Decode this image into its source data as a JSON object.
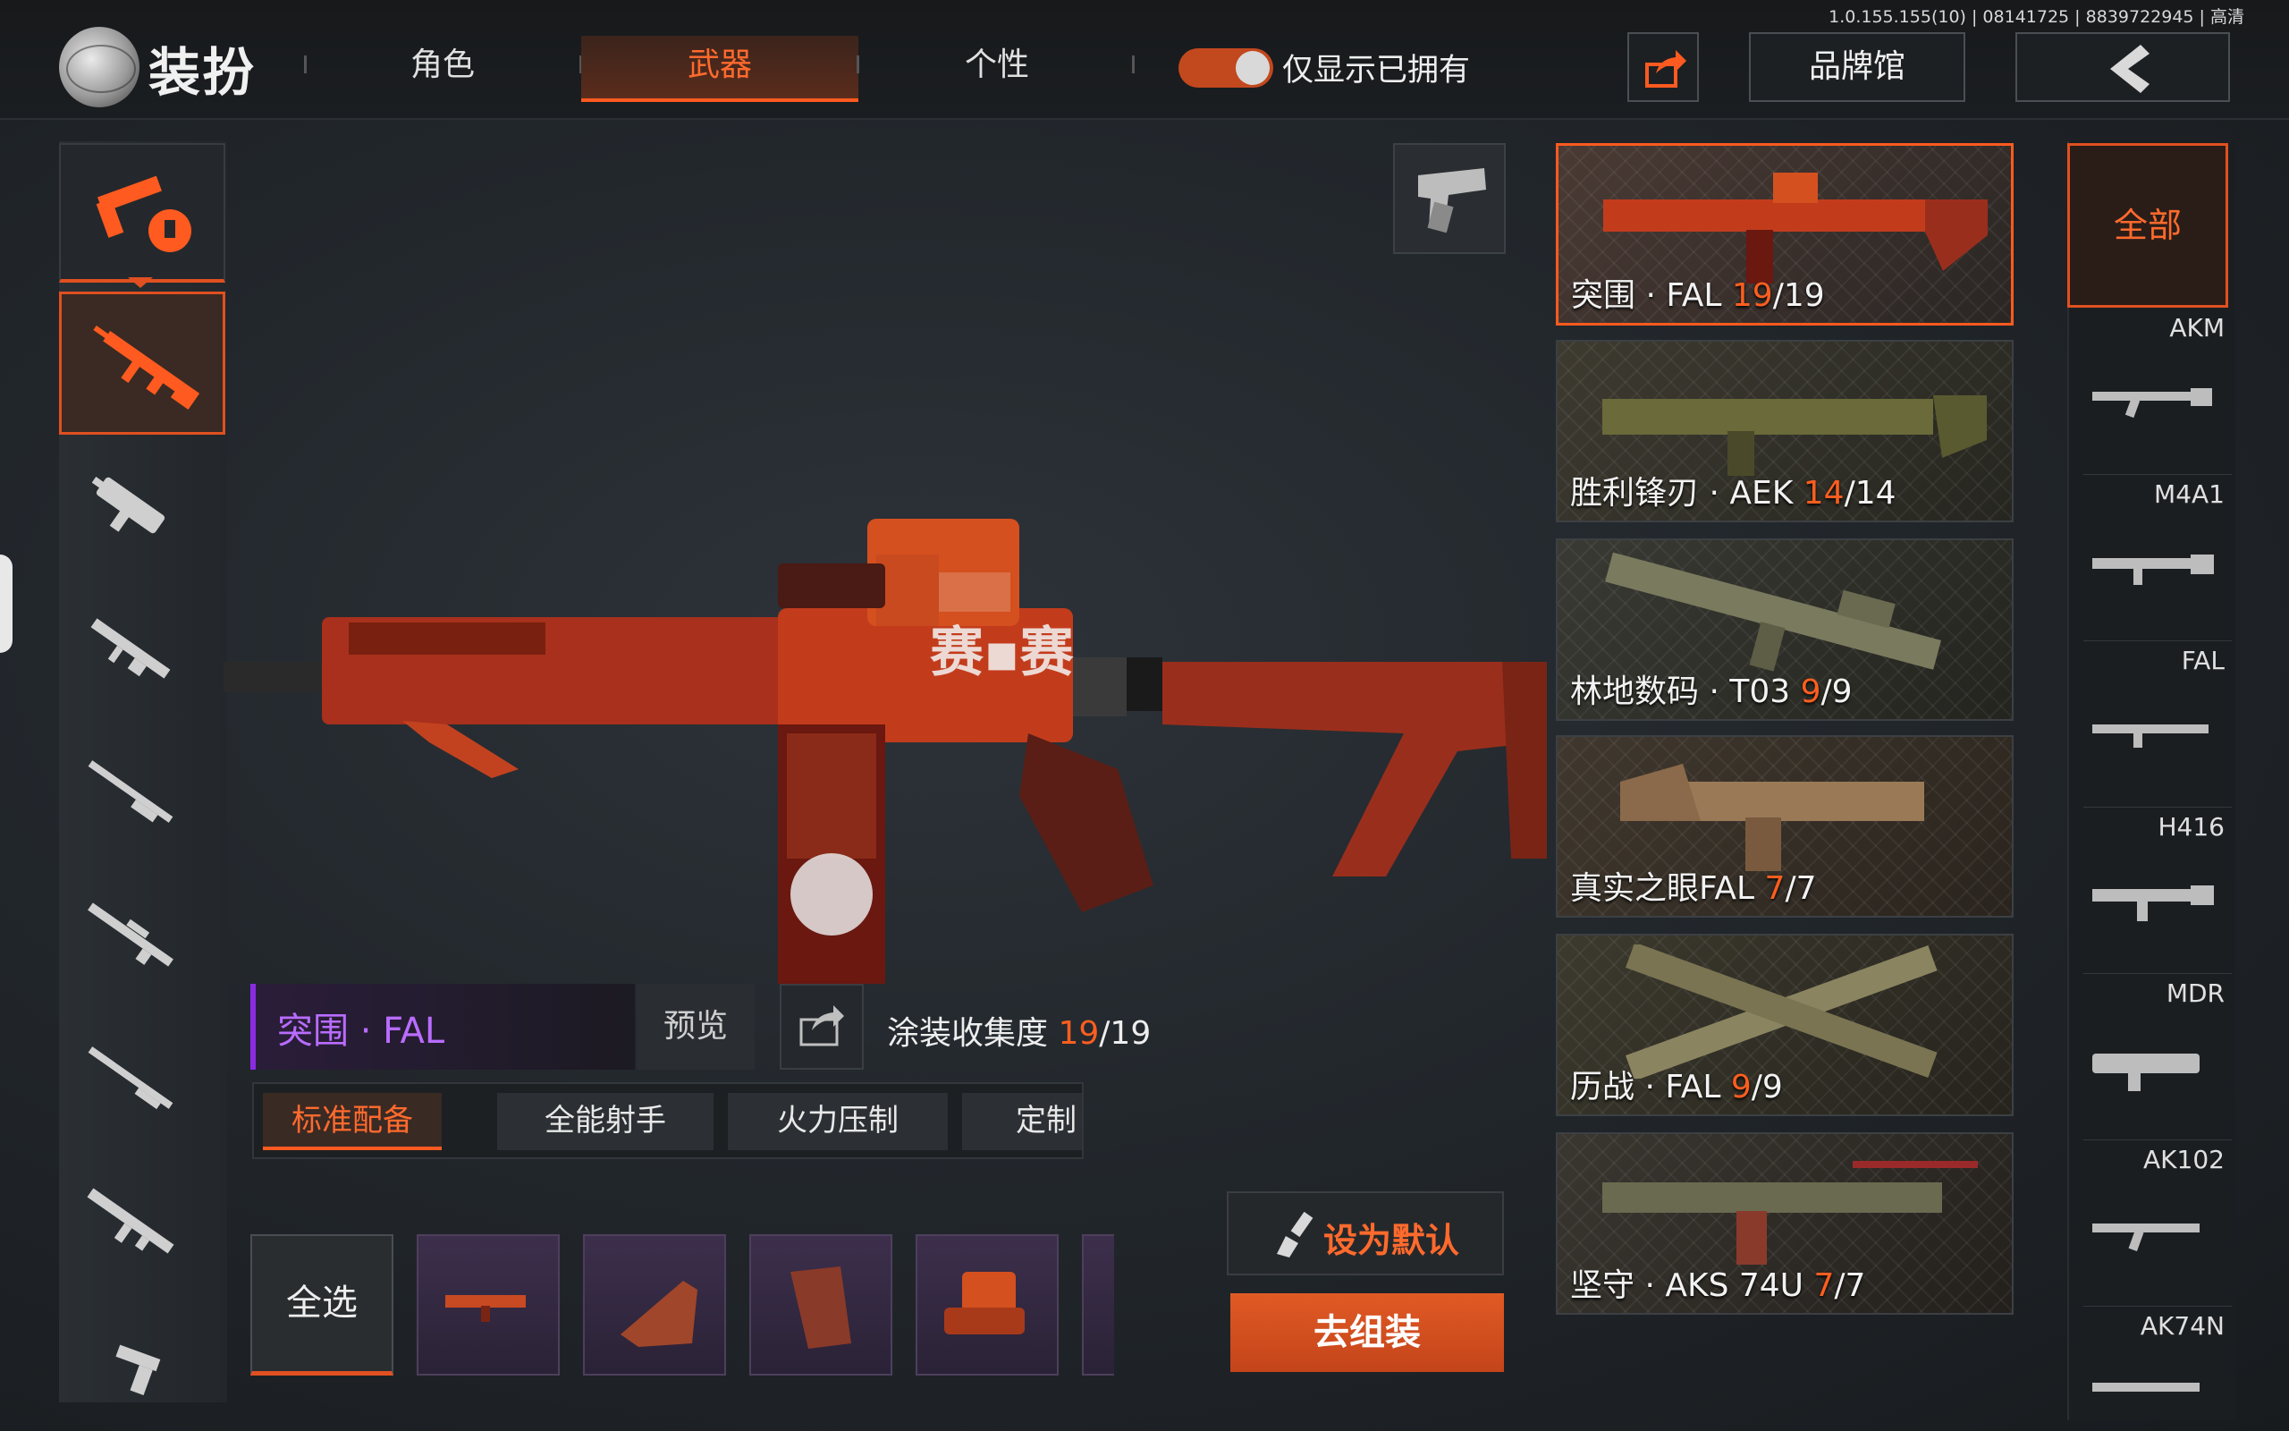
{
  "version_text": "1.0.155.155(10) | 08141725 | 8839722945 | 高清",
  "header": {
    "title": "装扮",
    "tabs": [
      {
        "label": "角色",
        "active": false
      },
      {
        "label": "武器",
        "active": true
      },
      {
        "label": "个性",
        "active": false
      }
    ],
    "owned_toggle": {
      "label": "仅显示已拥有",
      "on": true
    },
    "brand_button": "品牌馆"
  },
  "current_skin": {
    "name": "突围 · FAL",
    "preview_label": "预览",
    "collection_label": "涂装收集度",
    "collected": "19",
    "total": "/19"
  },
  "loadouts": [
    "标准配备",
    "全能射手",
    "火力压制",
    "定制"
  ],
  "select_all_label": "全选",
  "set_default_label": "设为默认",
  "assemble_label": "去组装",
  "skins": [
    {
      "name": "突围 · FAL ",
      "count": "19",
      "total": "/19",
      "selected": true
    },
    {
      "name": "胜利锋刃 · AEK ",
      "count": "14",
      "total": "/14",
      "selected": false
    },
    {
      "name": "林地数码 · T03 ",
      "count": "9",
      "total": "/9",
      "selected": false
    },
    {
      "name": "真实之眼FAL ",
      "count": "7",
      "total": "/7",
      "selected": false
    },
    {
      "name": "历战 · FAL ",
      "count": "9",
      "total": "/9",
      "selected": false
    },
    {
      "name": "坚守 · AKS 74U ",
      "count": "7",
      "total": "/7",
      "selected": false
    }
  ],
  "weapon_filter": {
    "all_label": "全部",
    "weapons": [
      "AKM",
      "M4A1",
      "FAL",
      "H416",
      "MDR",
      "AK102",
      "AK74N"
    ]
  },
  "colors": {
    "accent": "#ff5a1f",
    "rarity_purple": "#b96cff"
  }
}
